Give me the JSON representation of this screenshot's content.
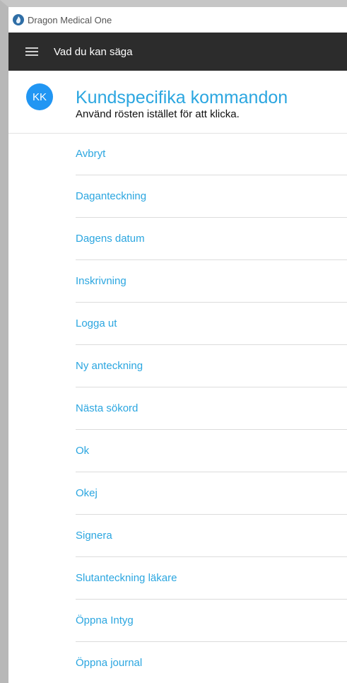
{
  "window": {
    "title": "Dragon Medical One"
  },
  "toolbar": {
    "menu_icon": "hamburger-menu-icon",
    "title": "Vad du kan säga"
  },
  "section": {
    "avatar_initials": "KK",
    "title": "Kundspecifika kommandon",
    "subtitle": "Använd rösten istället för att klicka."
  },
  "commands": [
    "Avbryt",
    "Daganteckning",
    "Dagens datum",
    "Inskrivning",
    "Logga ut",
    "Ny anteckning",
    "Nästa sökord",
    "Ok",
    "Okej",
    "Signera",
    "Slutanteckning läkare",
    "Öppna Intyg",
    "Öppna journal"
  ],
  "colors": {
    "toolbar_bg": "#2c2c2c",
    "accent": "#2ba6e0",
    "avatar_bg": "#2196f3"
  }
}
